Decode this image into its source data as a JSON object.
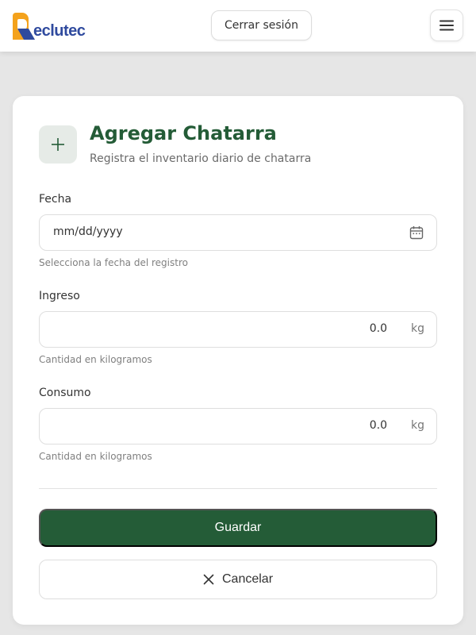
{
  "header": {
    "logo_text": "eclutec",
    "logout_label": "Cerrar sesión",
    "menu_icon": "hamburger-menu-icon"
  },
  "form": {
    "icon": "plus-icon",
    "title": "Agregar Chatarra",
    "subtitle": "Registra el inventario diario de chatarra",
    "fecha": {
      "label": "Fecha",
      "value": "mm/dd/yyyy",
      "hint": "Selecciona la fecha del registro",
      "icon": "calendar-icon"
    },
    "ingreso": {
      "label": "Ingreso",
      "value": "0.0",
      "unit": "kg",
      "hint": "Cantidad en kilogramos"
    },
    "consumo": {
      "label": "Consumo",
      "value": "0.0",
      "unit": "kg",
      "hint": "Cantidad en kilogramos"
    },
    "save_label": "Guardar",
    "cancel_label": "Cancelar",
    "cancel_icon": "close-icon"
  },
  "colors": {
    "brand_green": "#245c37",
    "logo_orange": "#f4a21c",
    "logo_blue": "#2f4a9e",
    "page_bg": "#e6e6e6"
  }
}
